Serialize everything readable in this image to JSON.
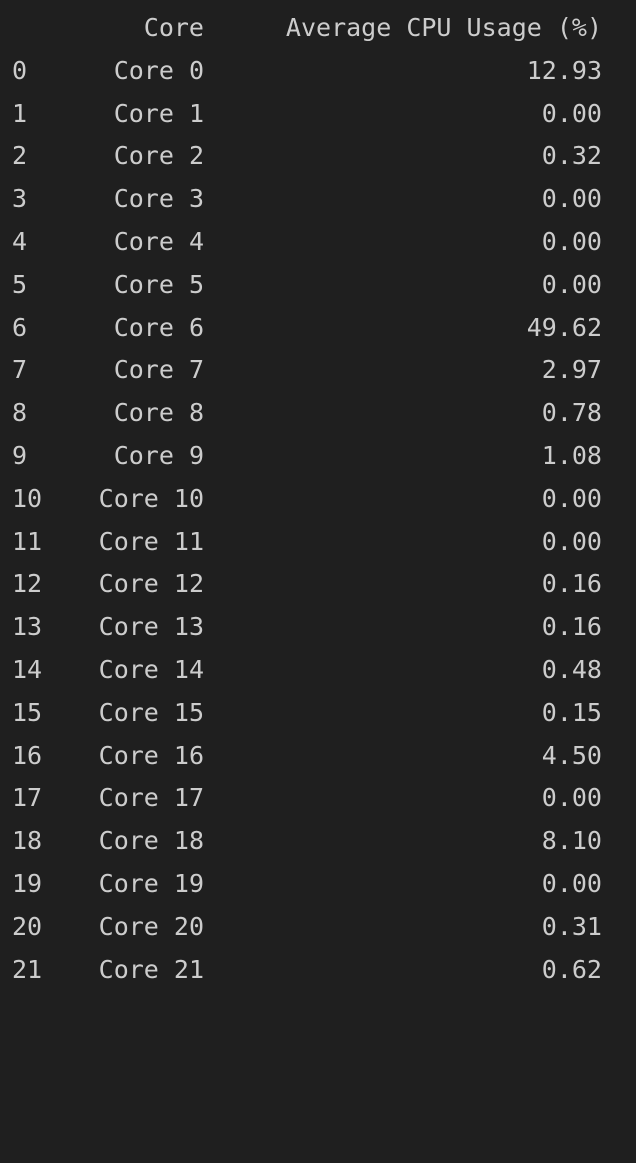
{
  "header": {
    "index": "",
    "core": "Core",
    "usage": "Average CPU Usage (%)"
  },
  "rows": [
    {
      "index": "0",
      "core": "Core 0",
      "usage": "12.93"
    },
    {
      "index": "1",
      "core": "Core 1",
      "usage": "0.00"
    },
    {
      "index": "2",
      "core": "Core 2",
      "usage": "0.32"
    },
    {
      "index": "3",
      "core": "Core 3",
      "usage": "0.00"
    },
    {
      "index": "4",
      "core": "Core 4",
      "usage": "0.00"
    },
    {
      "index": "5",
      "core": "Core 5",
      "usage": "0.00"
    },
    {
      "index": "6",
      "core": "Core 6",
      "usage": "49.62"
    },
    {
      "index": "7",
      "core": "Core 7",
      "usage": "2.97"
    },
    {
      "index": "8",
      "core": "Core 8",
      "usage": "0.78"
    },
    {
      "index": "9",
      "core": "Core 9",
      "usage": "1.08"
    },
    {
      "index": "10",
      "core": "Core 10",
      "usage": "0.00"
    },
    {
      "index": "11",
      "core": "Core 11",
      "usage": "0.00"
    },
    {
      "index": "12",
      "core": "Core 12",
      "usage": "0.16"
    },
    {
      "index": "13",
      "core": "Core 13",
      "usage": "0.16"
    },
    {
      "index": "14",
      "core": "Core 14",
      "usage": "0.48"
    },
    {
      "index": "15",
      "core": "Core 15",
      "usage": "0.15"
    },
    {
      "index": "16",
      "core": "Core 16",
      "usage": "4.50"
    },
    {
      "index": "17",
      "core": "Core 17",
      "usage": "0.00"
    },
    {
      "index": "18",
      "core": "Core 18",
      "usage": "8.10"
    },
    {
      "index": "19",
      "core": "Core 19",
      "usage": "0.00"
    },
    {
      "index": "20",
      "core": "Core 20",
      "usage": "0.31"
    },
    {
      "index": "21",
      "core": "Core 21",
      "usage": "0.62"
    }
  ]
}
